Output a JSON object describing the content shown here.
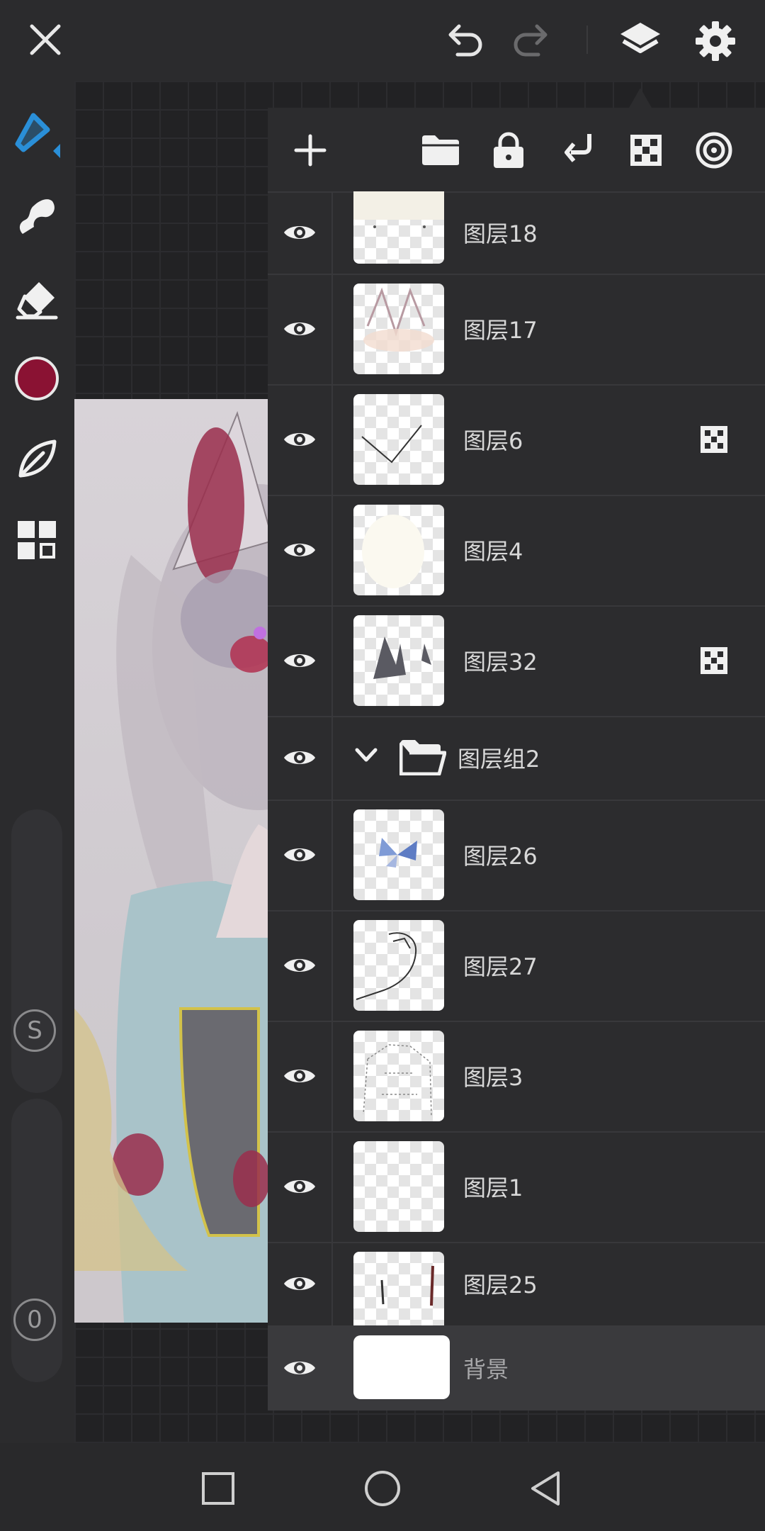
{
  "toolbar_top": {
    "close": "close-icon",
    "undo": "undo-icon",
    "redo": "redo-icon",
    "layers": "layers-icon",
    "settings": "gear-icon"
  },
  "tools": {
    "active_color": "#8a1233",
    "accent": "#2a8fd8",
    "size_slider_label": "S",
    "opacity_slider_label": "0"
  },
  "layers_panel": {
    "actions": [
      "add-layer",
      "folder",
      "lock",
      "merge-down",
      "alpha-lock",
      "reference"
    ],
    "layers": [
      {
        "name": "图层18",
        "visible": true,
        "alpha_locked": false
      },
      {
        "name": "图层17",
        "visible": true,
        "alpha_locked": false
      },
      {
        "name": "图层6",
        "visible": true,
        "alpha_locked": true
      },
      {
        "name": "图层4",
        "visible": true,
        "alpha_locked": false
      },
      {
        "name": "图层32",
        "visible": true,
        "alpha_locked": true
      }
    ],
    "group": {
      "name": "图层组2",
      "expanded": true,
      "visible": true
    },
    "group_layers": [
      {
        "name": "图层26",
        "visible": true
      },
      {
        "name": "图层27",
        "visible": true
      },
      {
        "name": "图层3",
        "visible": true
      },
      {
        "name": "图层1",
        "visible": true
      },
      {
        "name": "图层25",
        "visible": true
      }
    ],
    "background": {
      "name": "背景",
      "visible": true
    }
  }
}
